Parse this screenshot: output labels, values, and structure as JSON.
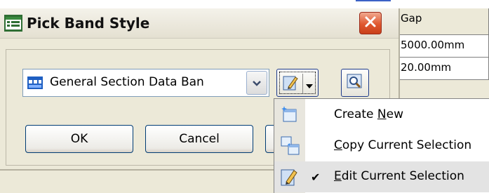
{
  "dialog": {
    "title": "Pick Band Style",
    "combo_value": "General Section Data Ban",
    "ok_label": "OK",
    "cancel_label": "Cancel",
    "icons": {
      "title": "band-style-icon",
      "combo": "band-icon",
      "edit": "pencil-edit-icon",
      "preview": "magnifier-preview-icon",
      "close": "close-icon"
    }
  },
  "background_table": {
    "header": "Gap",
    "rows": [
      "5000.00mm",
      "20.00mm"
    ]
  },
  "menu": {
    "items": [
      {
        "label_pre": "Create ",
        "mnemonic": "N",
        "label_post": "ew",
        "icon": "create-new-icon",
        "checked": false
      },
      {
        "label_pre": "",
        "mnemonic": "C",
        "label_post": "opy Current Selection",
        "icon": "copy-icon",
        "checked": false
      },
      {
        "label_pre": "",
        "mnemonic": "E",
        "label_post": "dit Current Selection",
        "icon": "pencil-edit-icon",
        "checked": true
      }
    ],
    "check_mark": "✔"
  },
  "colors": {
    "accent": "#1e3a8a",
    "close": "#e0582f",
    "highlight": "#e3e3e3"
  }
}
